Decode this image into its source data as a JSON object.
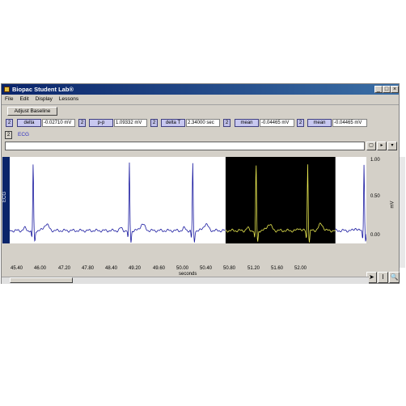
{
  "window": {
    "title": "Biopac Student Lab®"
  },
  "titlebar_buttons": [
    "_",
    "□",
    "×"
  ],
  "menu": [
    "File",
    "Edit",
    "Display",
    "Lessons"
  ],
  "toolbar": {
    "adjust_baseline": "Adjust Baseline"
  },
  "measurements": [
    {
      "channel": "2",
      "label": "delta",
      "value": "-0.02710 mV"
    },
    {
      "channel": "2",
      "label": "p-p",
      "value": "1.09332 mV"
    },
    {
      "channel": "2",
      "label": "delta T",
      "value": "2.34000 sec"
    },
    {
      "channel": "2",
      "label": "mean",
      "value": "-0.04465 mV"
    },
    {
      "channel": "2",
      "label": "mean",
      "value": "-0.04465 mV"
    }
  ],
  "channel": {
    "number": "2",
    "name": "ECG",
    "strip_label": "ECG"
  },
  "journal_buttons": [
    "▢",
    "▸",
    "▾"
  ],
  "y_axis": {
    "ticks": [
      "1.00",
      "0.50",
      "0.00"
    ],
    "unit": "mV"
  },
  "x_axis": {
    "ticks": [
      "45.40",
      "46.00",
      "47.20",
      "47.80",
      "48.40",
      "49.20",
      "49.60",
      "50.00",
      "50.40",
      "50.80",
      "51.20",
      "51.60",
      "52.00"
    ],
    "unit": "seconds"
  },
  "tools": {
    "arrow_icon": "pointer-icon",
    "ibeam_icon": "i-beam-icon",
    "zoom_icon": "zoom-icon"
  },
  "colors": {
    "trace_normal": "#1a1aa0",
    "trace_selected": "#e8e850",
    "selected_bg": "#000000",
    "title_bar": "#0a246a"
  },
  "chart_data": {
    "type": "line",
    "xlabel": "seconds",
    "ylabel": "mV",
    "ylim": [
      -0.25,
      1.1
    ],
    "xlim": [
      45.4,
      53.0
    ],
    "selection": [
      50.0,
      52.34
    ],
    "r_peaks": [
      45.9,
      47.95,
      49.3,
      50.65,
      51.75,
      52.95
    ]
  }
}
